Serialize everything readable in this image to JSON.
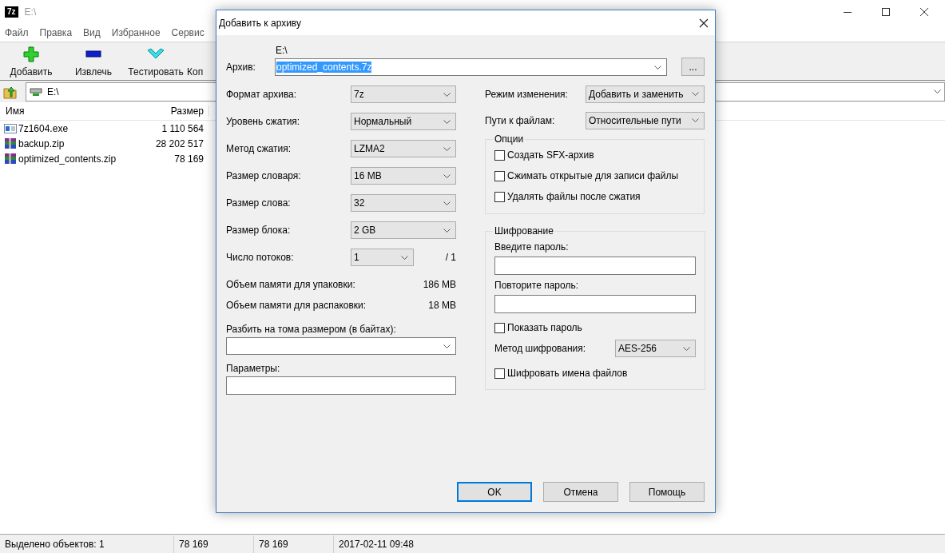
{
  "window": {
    "logo": "7z",
    "title": "E:\\"
  },
  "menu": [
    "Файл",
    "Правка",
    "Вид",
    "Избранное",
    "Сервис"
  ],
  "toolbar": [
    {
      "label": "Добавить",
      "kind": "plus"
    },
    {
      "label": "Извлечь",
      "kind": "minus"
    },
    {
      "label": "Тестировать",
      "kind": "check"
    },
    {
      "label": "Коп",
      "kind": "none"
    }
  ],
  "address": {
    "path": "E:\\"
  },
  "file_list": {
    "columns": [
      "Имя",
      "Размер"
    ],
    "rows": [
      {
        "name": "7z1604.exe",
        "size": "1 110 564",
        "kind": "exe"
      },
      {
        "name": "backup.zip",
        "size": "28 202 517",
        "kind": "archive"
      },
      {
        "name": "optimized_contents.zip",
        "size": "78 169",
        "kind": "archive"
      }
    ]
  },
  "status_bar": [
    "Выделено объектов: 1",
    "78 169",
    "78 169",
    "2017-02-11 09:48"
  ],
  "dialog": {
    "title": "Добавить к архиву",
    "archive": {
      "label": "Архив:",
      "folder": "E:\\",
      "value": "optimized_contents.7z",
      "highlighted": true,
      "browse": "..."
    },
    "left_settings": [
      {
        "label": "Формат архива:",
        "value": "7z"
      },
      {
        "label": "Уровень сжатия:",
        "value": "Нормальный"
      },
      {
        "label": "Метод сжатия:",
        "value": "LZMA2"
      },
      {
        "label": "Размер словаря:",
        "value": "16 MB"
      },
      {
        "label": "Размер слова:",
        "value": "32"
      },
      {
        "label": "Размер блока:",
        "value": "2 GB"
      },
      {
        "label": "Число потоков:",
        "value": "1",
        "note": "/ 1"
      }
    ],
    "memory": [
      {
        "label": "Объем памяти для упаковки:",
        "value": "186 MB"
      },
      {
        "label": "Объем памяти для распаковки:",
        "value": "18 MB"
      }
    ],
    "split": {
      "label": "Разбить на тома размером (в байтах):"
    },
    "parameters": {
      "label": "Параметры:"
    },
    "right_settings": [
      {
        "label": "Режим изменения:",
        "value": "Добавить и заменить"
      },
      {
        "label": "Пути к файлам:",
        "value": "Относительные пути"
      }
    ],
    "options": {
      "title": "Опции",
      "items": [
        {
          "label": "Создать SFX-архив",
          "checked": false
        },
        {
          "label": "Сжимать открытые для записи файлы",
          "checked": false
        },
        {
          "label": "Удалять файлы после сжатия",
          "checked": false
        }
      ]
    },
    "encryption": {
      "title": "Шифрование",
      "password_label": "Введите пароль:",
      "repeat_label": "Повторите пароль:",
      "show_password": {
        "label": "Показать пароль",
        "checked": false
      },
      "method": {
        "label": "Метод шифрования:",
        "value": "AES-256"
      },
      "encrypt_names": {
        "label": "Шифровать имена файлов",
        "checked": false
      }
    },
    "buttons": [
      {
        "label": "OK",
        "default": true
      },
      {
        "label": "Отмена",
        "default": false
      },
      {
        "label": "Помощь",
        "default": false
      }
    ]
  }
}
